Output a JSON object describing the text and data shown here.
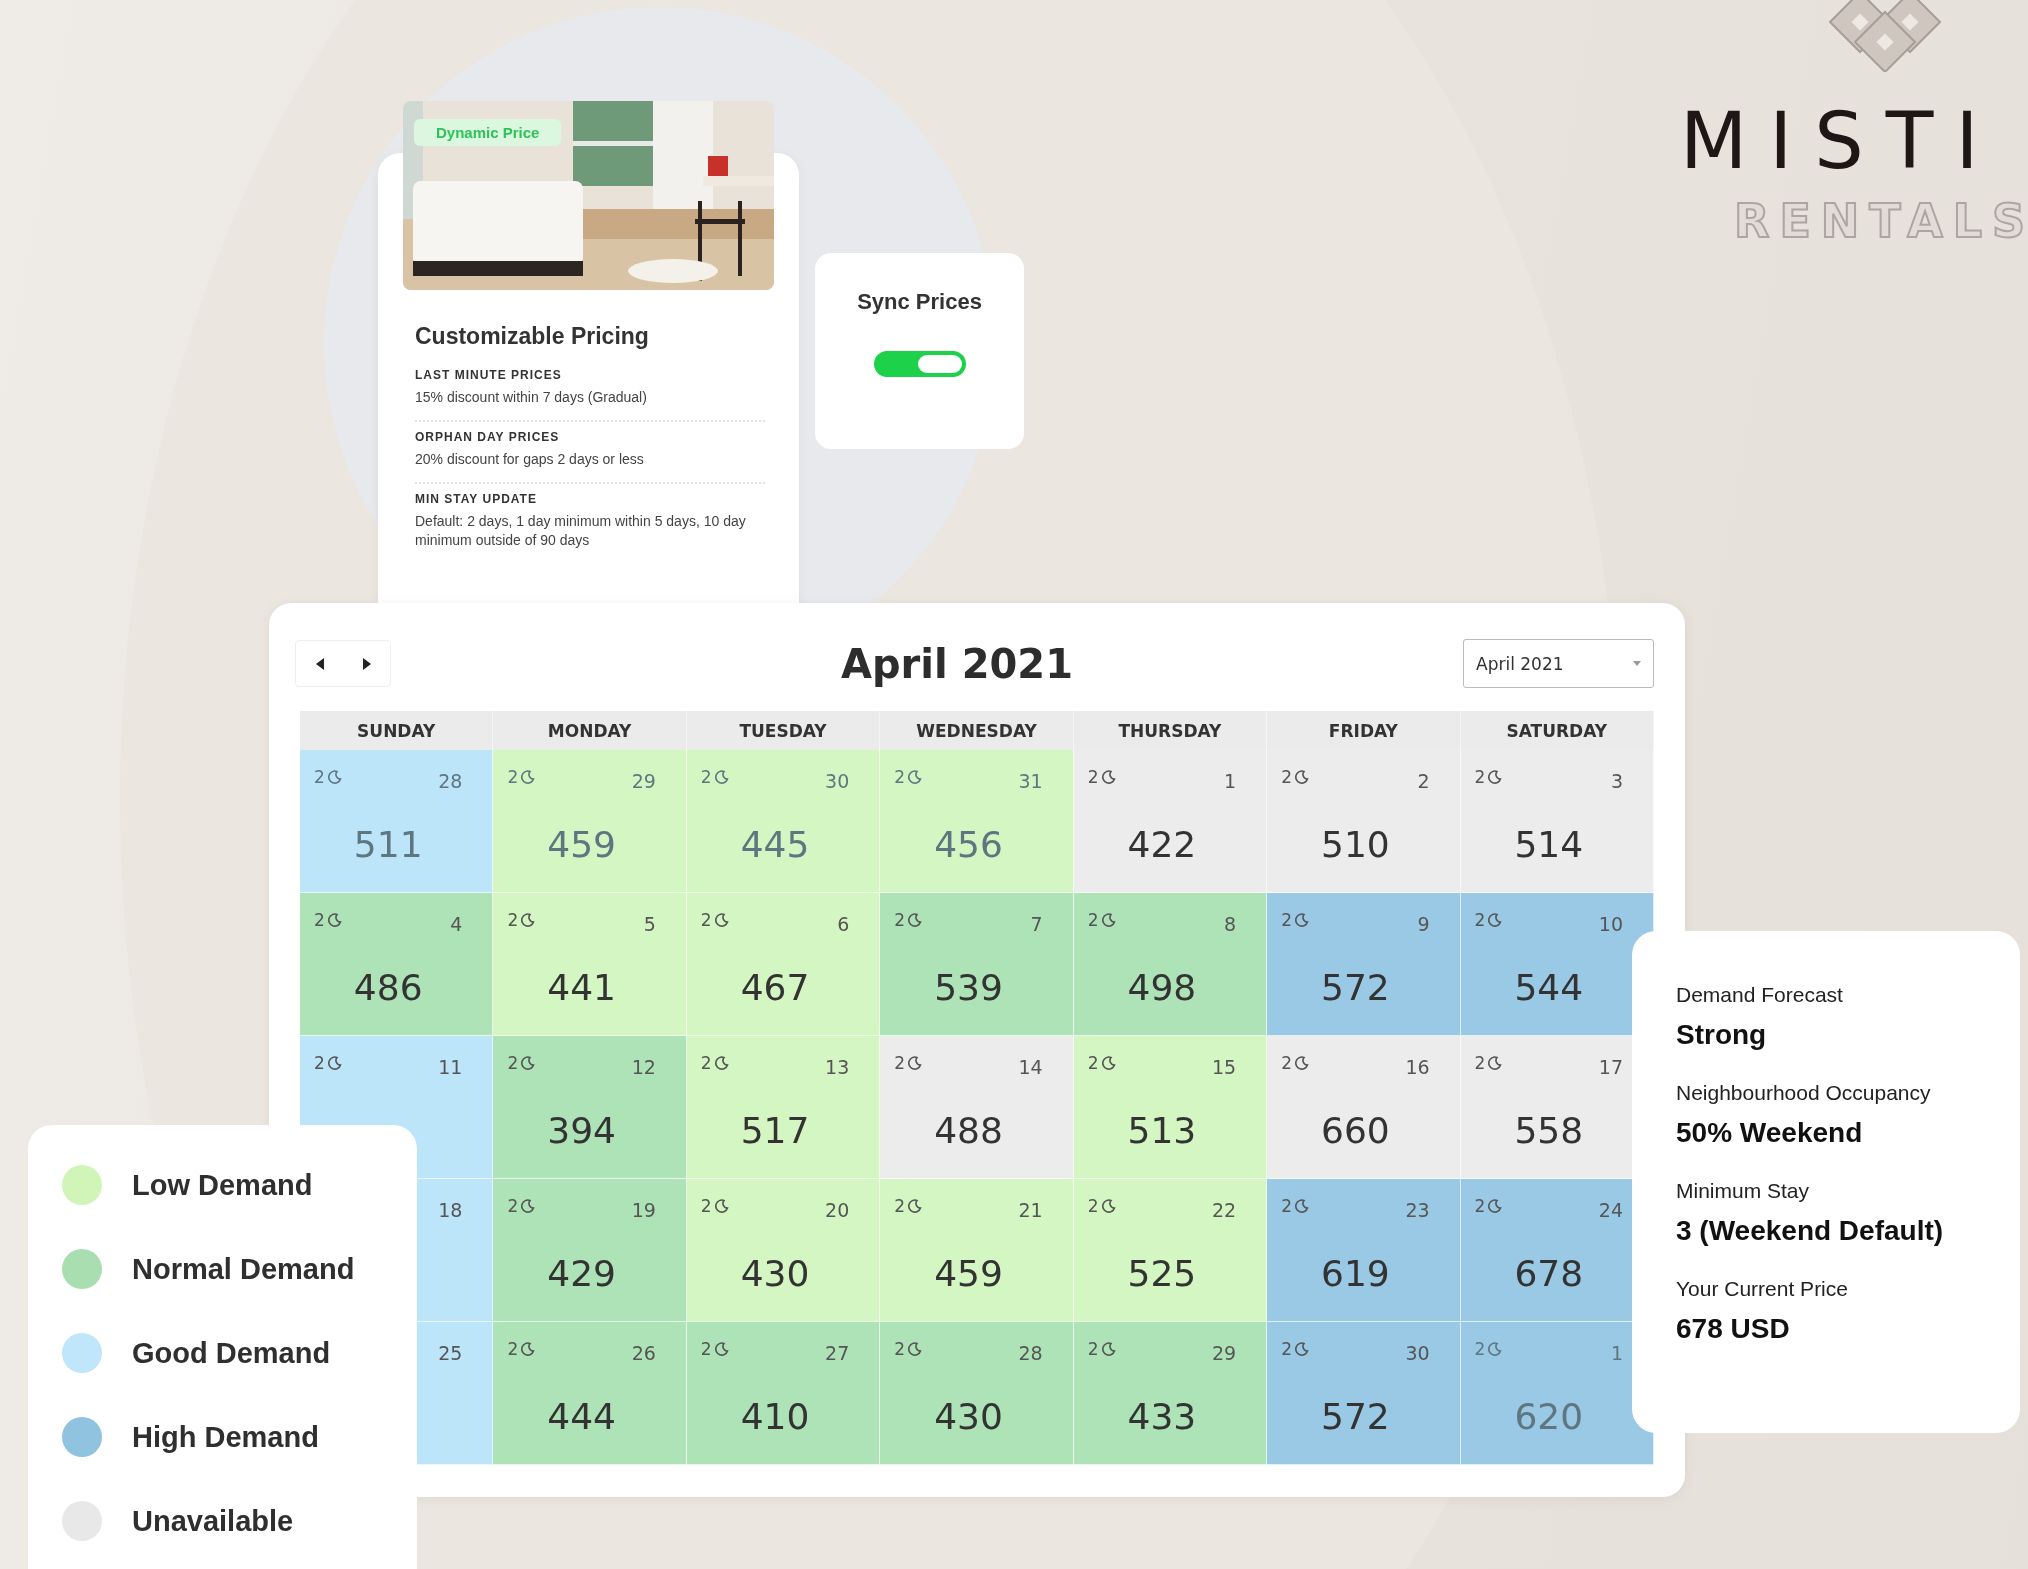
{
  "logo": {
    "name": "MISTI",
    "tagline": "RENTALS"
  },
  "pricing_card": {
    "badge": "Dynamic Price",
    "title": "Customizable Pricing",
    "rules": [
      {
        "label": "LAST MINUTE PRICES",
        "text": "15% discount within 7 days (Gradual)"
      },
      {
        "label": "ORPHAN DAY PRICES",
        "text": "20% discount for gaps 2 days or less"
      },
      {
        "label": "MIN STAY UPDATE",
        "text": "Default: 2 days, 1 day minimum within 5 days, 10 day minimum outside of 90 days"
      }
    ]
  },
  "sync_card": {
    "title": "Sync Prices",
    "toggle": {
      "on": true
    }
  },
  "calendar": {
    "title": "April 2021",
    "month_select": {
      "value": "April 2021"
    },
    "columns": [
      "SUNDAY",
      "MONDAY",
      "TUESDAY",
      "WEDNESDAY",
      "THURSDAY",
      "FRIDAY",
      "SATURDAY"
    ],
    "rows": [
      [
        {
          "nights": "2",
          "day": "28",
          "price": "511",
          "color": "#bde5f9",
          "faded": true
        },
        {
          "nights": "2",
          "day": "29",
          "price": "459",
          "color": "#d4f6c2",
          "faded": true
        },
        {
          "nights": "2",
          "day": "30",
          "price": "445",
          "color": "#d4f6c2",
          "faded": true
        },
        {
          "nights": "2",
          "day": "31",
          "price": "456",
          "color": "#d4f6c2",
          "faded": true
        },
        {
          "nights": "2",
          "day": "1",
          "price": "422",
          "color": "#ececec",
          "faded": false
        },
        {
          "nights": "2",
          "day": "2",
          "price": "510",
          "color": "#ececec",
          "faded": false
        },
        {
          "nights": "2",
          "day": "3",
          "price": "514",
          "color": "#ececec",
          "faded": false
        }
      ],
      [
        {
          "nights": "2",
          "day": "4",
          "price": "486",
          "color": "#ade3b6",
          "faded": false
        },
        {
          "nights": "2",
          "day": "5",
          "price": "441",
          "color": "#d4f6c2",
          "faded": false
        },
        {
          "nights": "2",
          "day": "6",
          "price": "467",
          "color": "#d4f6c2",
          "faded": false
        },
        {
          "nights": "2",
          "day": "7",
          "price": "539",
          "color": "#ade3b6",
          "faded": false
        },
        {
          "nights": "2",
          "day": "8",
          "price": "498",
          "color": "#ade3b6",
          "faded": false
        },
        {
          "nights": "2",
          "day": "9",
          "price": "572",
          "color": "#99c9e4",
          "faded": false
        },
        {
          "nights": "2",
          "day": "10",
          "price": "544",
          "color": "#99c9e4",
          "faded": false
        }
      ],
      [
        {
          "nights": "2",
          "day": "11",
          "color": "#bde5f9",
          "faded": false
        },
        {
          "nights": "2",
          "day": "12",
          "price": "394",
          "color": "#ade3b6",
          "faded": false
        },
        {
          "nights": "2",
          "day": "13",
          "price": "517",
          "color": "#d4f6c2",
          "faded": false
        },
        {
          "nights": "2",
          "day": "14",
          "price": "488",
          "color": "#ececec",
          "faded": false
        },
        {
          "nights": "2",
          "day": "15",
          "price": "513",
          "color": "#d4f6c2",
          "faded": false
        },
        {
          "nights": "2",
          "day": "16",
          "price": "660",
          "color": "#ececec",
          "faded": false
        },
        {
          "nights": "2",
          "day": "17",
          "price": "558",
          "color": "#ececec",
          "faded": false
        }
      ],
      [
        {
          "day": "18",
          "color": "#bde5f9",
          "faded": false
        },
        {
          "nights": "2",
          "day": "19",
          "price": "429",
          "color": "#ade3b6",
          "faded": false
        },
        {
          "nights": "2",
          "day": "20",
          "price": "430",
          "color": "#d4f6c2",
          "faded": false
        },
        {
          "nights": "2",
          "day": "21",
          "price": "459",
          "color": "#d4f6c2",
          "faded": false
        },
        {
          "nights": "2",
          "day": "22",
          "price": "525",
          "color": "#d4f6c2",
          "faded": false
        },
        {
          "nights": "2",
          "day": "23",
          "price": "619",
          "color": "#99c9e4",
          "faded": false
        },
        {
          "nights": "2",
          "day": "24",
          "price": "678",
          "color": "#99c9e4",
          "faded": false
        }
      ],
      [
        {
          "day": "25",
          "color": "#bde5f9",
          "faded": false
        },
        {
          "nights": "2",
          "day": "26",
          "price": "444",
          "color": "#ade3b6",
          "faded": false
        },
        {
          "nights": "2",
          "day": "27",
          "price": "410",
          "color": "#ade3b6",
          "faded": false
        },
        {
          "nights": "2",
          "day": "28",
          "price": "430",
          "color": "#ade3b6",
          "faded": false
        },
        {
          "nights": "2",
          "day": "29",
          "price": "433",
          "color": "#ade3b6",
          "faded": false
        },
        {
          "nights": "2",
          "day": "30",
          "price": "572",
          "color": "#99c9e4",
          "faded": false
        },
        {
          "nights": "2",
          "day": "1",
          "price": "620",
          "color": "#99c9e4",
          "faded": true
        }
      ]
    ]
  },
  "legend": [
    {
      "label": "Low Demand",
      "color": "#d1f5b9"
    },
    {
      "label": "Normal Demand",
      "color": "#a9dfb0"
    },
    {
      "label": "Good Demand",
      "color": "#bfe6fa"
    },
    {
      "label": "High Demand",
      "color": "#8fc3e0"
    },
    {
      "label": "Unavailable",
      "color": "#e8e8e8"
    }
  ],
  "forecast_panel": {
    "items": [
      {
        "label": "Demand Forecast",
        "value": "Strong"
      },
      {
        "label": "Neighbourhood Occupancy",
        "value": "50% Weekend"
      },
      {
        "label": "Minimum Stay",
        "value": "3 (Weekend Default)"
      },
      {
        "label": "Your Current Price",
        "value": "678 USD"
      }
    ]
  }
}
